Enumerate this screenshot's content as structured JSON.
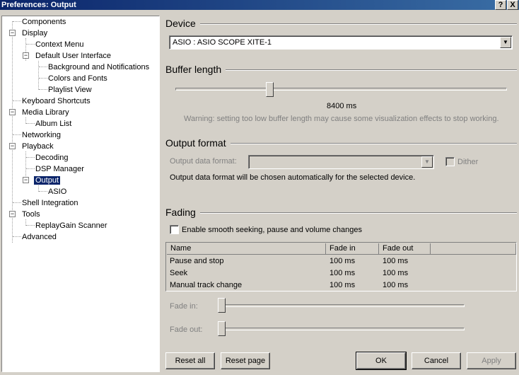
{
  "window": {
    "title": "Preferences: Output",
    "help_glyph": "?",
    "close_glyph": "X"
  },
  "tree": {
    "items": [
      {
        "label": "Components"
      },
      {
        "label": "Display",
        "toggle": "−"
      },
      {
        "label": "Context Menu"
      },
      {
        "label": "Default User Interface",
        "toggle": "−"
      },
      {
        "label": "Background and Notifications"
      },
      {
        "label": "Colors and Fonts"
      },
      {
        "label": "Playlist View"
      },
      {
        "label": "Keyboard Shortcuts"
      },
      {
        "label": "Media Library",
        "toggle": "−"
      },
      {
        "label": "Album List"
      },
      {
        "label": "Networking"
      },
      {
        "label": "Playback",
        "toggle": "−"
      },
      {
        "label": "Decoding"
      },
      {
        "label": "DSP Manager"
      },
      {
        "label": "Output",
        "toggle": "−",
        "selected": true
      },
      {
        "label": "ASIO"
      },
      {
        "label": "Shell Integration"
      },
      {
        "label": "Tools",
        "toggle": "−"
      },
      {
        "label": "ReplayGain Scanner"
      },
      {
        "label": "Advanced"
      }
    ]
  },
  "device": {
    "title": "Device",
    "selected": "ASIO : ASIO SCOPE XITE-1"
  },
  "buffer": {
    "title": "Buffer length",
    "value_label": "8400 ms",
    "level": 0.28,
    "warning": "Warning: setting too low buffer length may cause some visualization effects to stop working."
  },
  "output_format": {
    "title": "Output format",
    "data_format_label": "Output data format:",
    "data_format_value": "",
    "dither_label": "Dither",
    "info": "Output data format will be chosen automatically for the selected device."
  },
  "fading": {
    "title": "Fading",
    "enable_label": "Enable smooth seeking, pause and volume changes",
    "columns": [
      "Name",
      "Fade in",
      "Fade out"
    ],
    "rows": [
      [
        "Pause and stop",
        "100 ms",
        "100 ms"
      ],
      [
        "Seek",
        "100 ms",
        "100 ms"
      ],
      [
        "Manual track change",
        "100 ms",
        "100 ms"
      ]
    ],
    "fade_in_label": "Fade in:",
    "fade_out_label": "Fade out:",
    "fade_in_level": 0.0,
    "fade_out_level": 0.0
  },
  "buttons": {
    "reset_all": "Reset all",
    "reset_page": "Reset page",
    "ok": "OK",
    "cancel": "Cancel",
    "apply": "Apply"
  }
}
